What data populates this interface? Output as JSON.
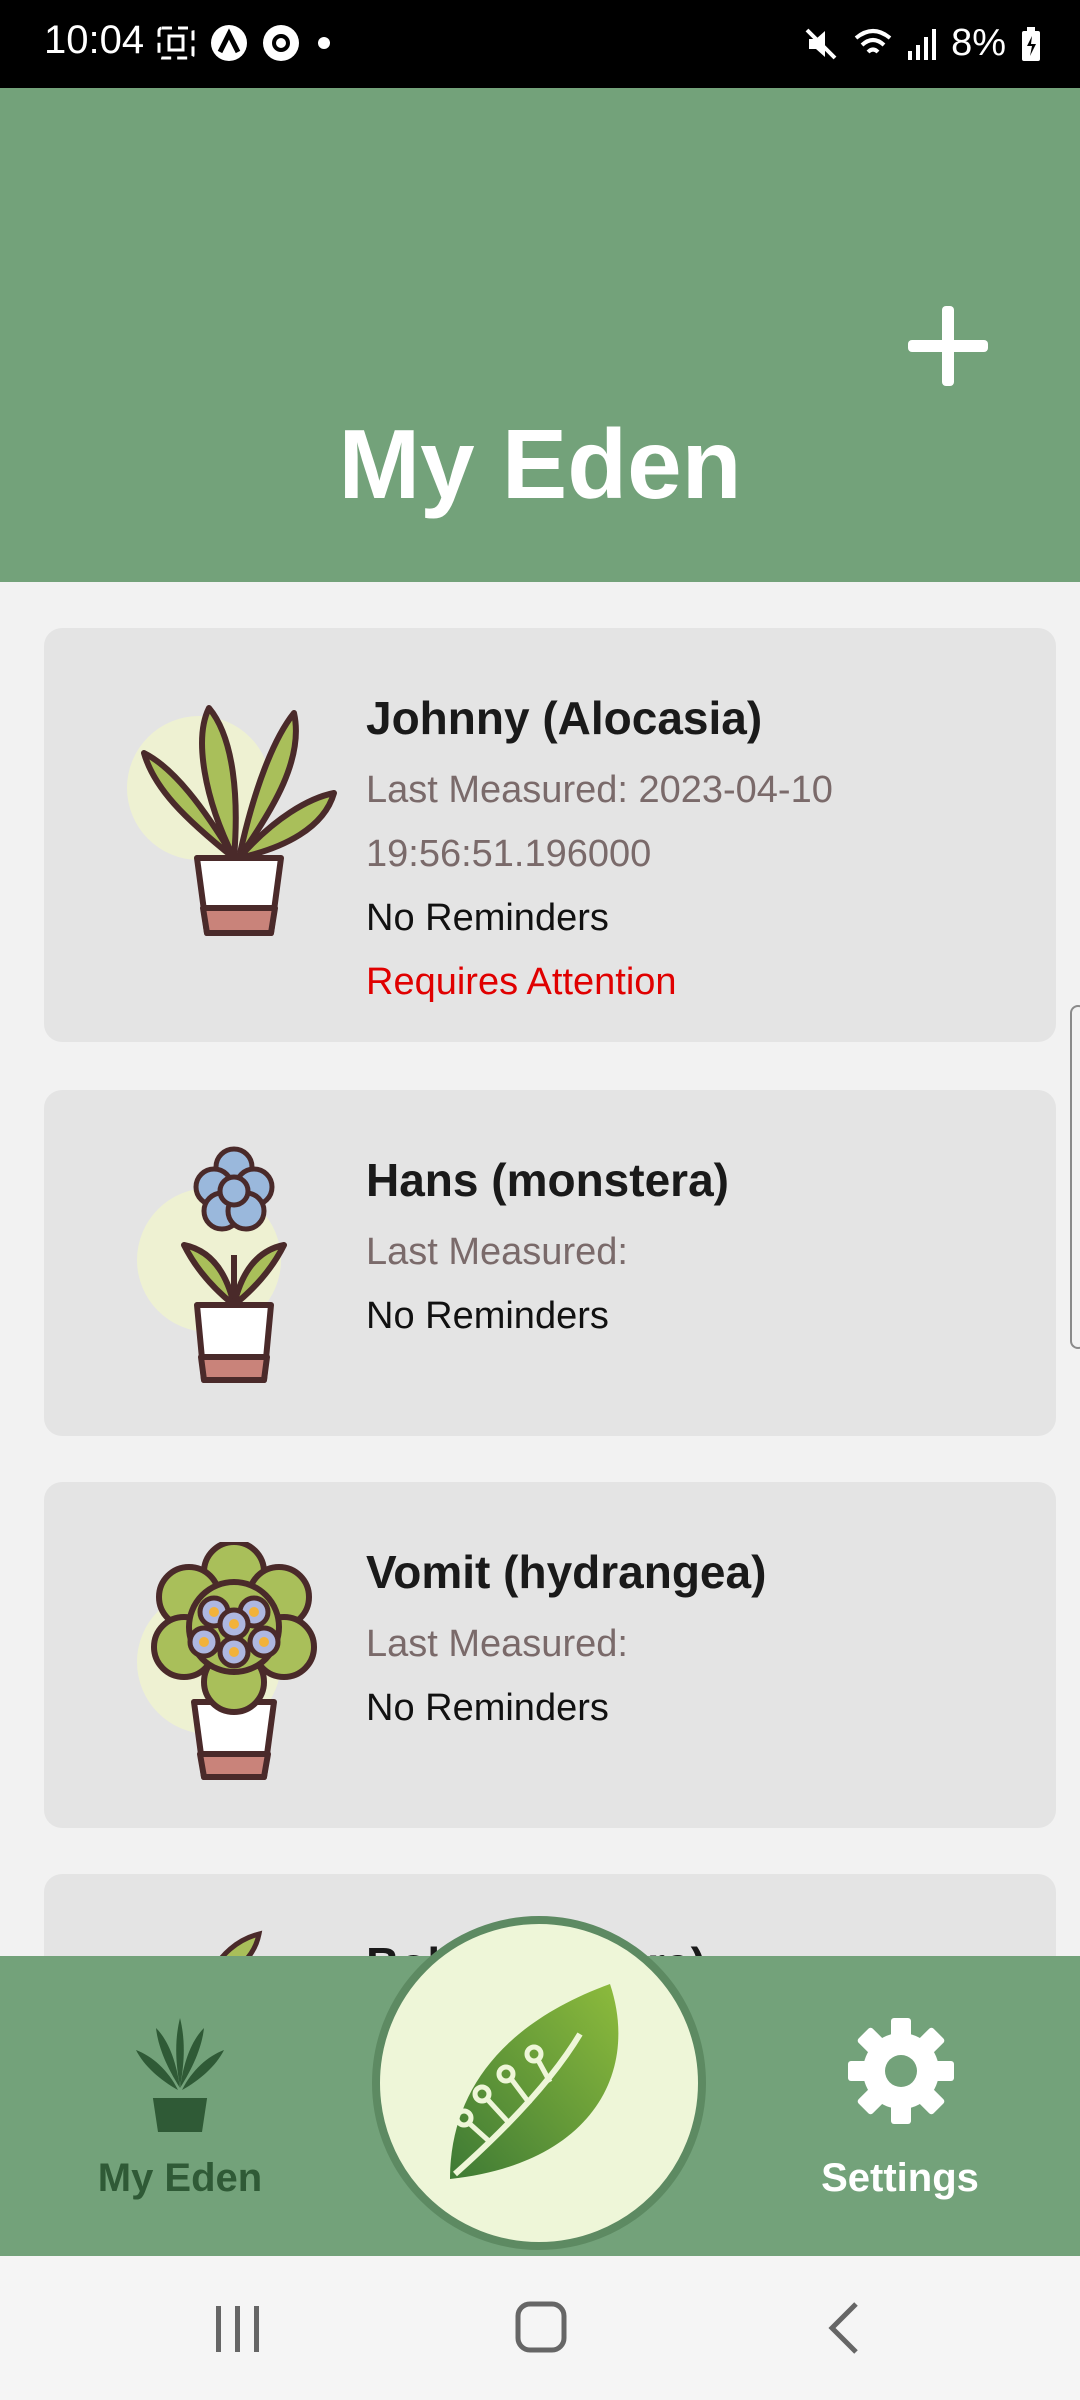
{
  "status_bar": {
    "time": "10:04",
    "battery": "8%"
  },
  "header": {
    "title": "My Eden",
    "add_icon": "plus-icon"
  },
  "plants": [
    {
      "name": "Johnny (Alocasia)",
      "measured_label": "Last Measured: 2023-04-10",
      "measured_time": "19:56:51.196000",
      "reminders": "No Reminders",
      "alert": "Requires Attention"
    },
    {
      "name": "Hans (monstera)",
      "measured_label": "Last Measured:",
      "reminders": "No Reminders"
    },
    {
      "name": "Vomit (hydrangea)",
      "measured_label": "Last Measured:",
      "reminders": "No Reminders"
    },
    {
      "name": "Bob (monstera)"
    }
  ],
  "bottom_nav": {
    "my_eden": {
      "label": "My Eden",
      "icon": "plant-icon"
    },
    "center": {
      "icon": "leaf-circuit-icon"
    },
    "settings": {
      "label": "Settings",
      "icon": "gear-icon"
    }
  },
  "colors": {
    "header_green": "#73a27a",
    "alert_red": "#e00000",
    "label_dark_green": "#2f5a36"
  }
}
